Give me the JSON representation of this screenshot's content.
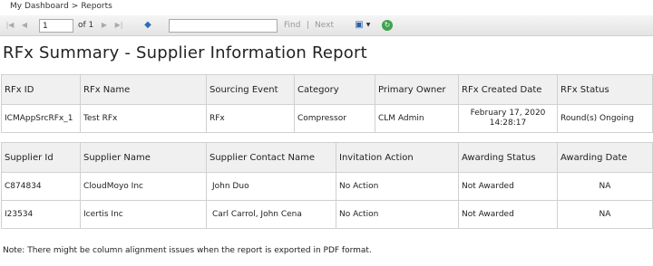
{
  "breadcrumb": {
    "home": "My Dashboard",
    "separator": ">",
    "current": "Reports"
  },
  "toolbar": {
    "page_value": "1",
    "of_label": "of 1",
    "find_label": "Find",
    "separator": "|",
    "next_label": "Next",
    "search_placeholder": ""
  },
  "title": "RFx Summary - Supplier Information Report",
  "rfx_table": {
    "headers": [
      "RFx ID",
      "RFx Name",
      "Sourcing Event",
      "Category",
      "Primary Owner",
      "RFx Created Date",
      "RFx Status"
    ],
    "rows": [
      {
        "id": "ICMAppSrcRFx_1",
        "name": "Test RFx",
        "event": "RFx",
        "category": "Compressor",
        "owner": "CLM Admin",
        "date_line1": "February 17, 2020",
        "date_line2": "14:28:17",
        "status": "Round(s) Ongoing"
      }
    ]
  },
  "supplier_table": {
    "headers": [
      "Supplier Id",
      "Supplier Name",
      "Supplier Contact Name",
      "Invitation Action",
      "Awarding Status",
      "Awarding Date"
    ],
    "rows": [
      {
        "id": "C874834",
        "name": "CloudMoyo Inc",
        "contact": "John Duo",
        "action": "No Action",
        "status": "Not Awarded",
        "date": "NA"
      },
      {
        "id": "I23534",
        "name": "Icertis Inc",
        "contact": "Carl Carrol, John Cena",
        "action": "No Action",
        "status": "Not Awarded",
        "date": "NA"
      }
    ]
  },
  "note": "Note: There might be column alignment issues when the report is exported in PDF format."
}
